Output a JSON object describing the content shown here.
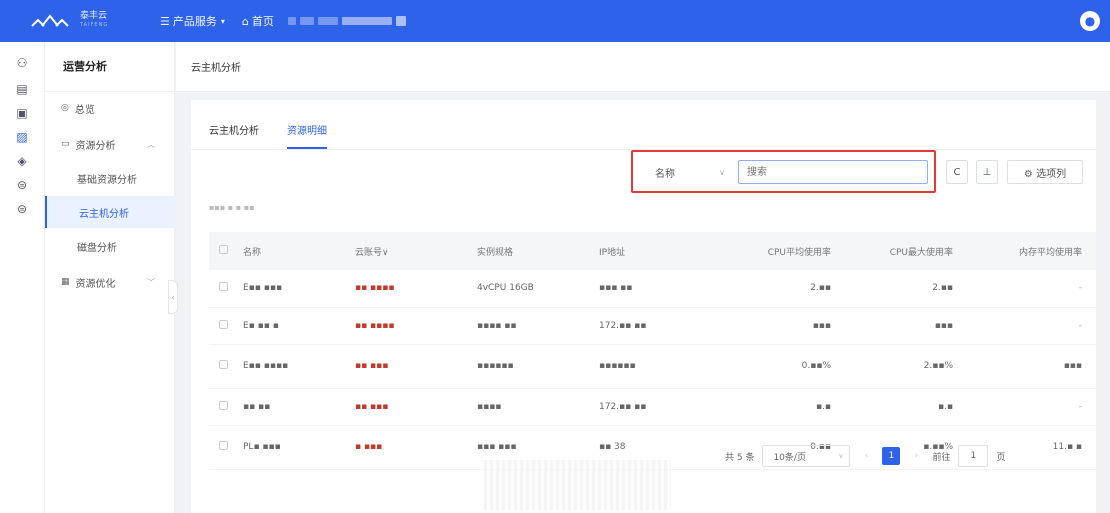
{
  "topbar": {
    "brand_cn": "泰丰云",
    "brand_en": "TAIFENG",
    "product_menu": "产品服务",
    "home": "首页",
    "avatar_initial": "●"
  },
  "rail_icons": [
    "users-icon",
    "server-icon",
    "document-icon",
    "monitor-icon",
    "shield-icon",
    "database-icon",
    "database-alt-icon"
  ],
  "sidebar": {
    "title": "运营分析",
    "items": [
      {
        "label": "总览",
        "icon": "◎"
      },
      {
        "label": "资源分析",
        "icon": "▭",
        "expanded": true
      },
      {
        "label": "基础资源分析"
      },
      {
        "label": "云主机分析",
        "active": true
      },
      {
        "label": "磁盘分析"
      },
      {
        "label": "资源优化",
        "icon": "▦"
      }
    ]
  },
  "breadcrumb": "云主机分析",
  "tabs": [
    {
      "label": "云主机分析"
    },
    {
      "label": "资源明细",
      "active": true
    }
  ],
  "filter": {
    "field": "名称",
    "placeholder": "搜索"
  },
  "toolbar": {
    "refresh": "C",
    "download": "⊥",
    "columns": "⚙ 选项列"
  },
  "table": {
    "columns": [
      "名称",
      "云账号∨",
      "实例规格",
      "IP地址",
      "CPU平均使用率",
      "CPU最大使用率",
      "内存平均使用率"
    ],
    "rows": [
      [
        "E▪▪ ▪▪▪",
        "▪▪ ▪▪▪▪",
        "4vCPU 16GB",
        "▪▪▪  ▪▪",
        "2.▪▪",
        "2.▪▪",
        "-"
      ],
      [
        "E▪ ▪▪ ▪",
        "▪▪ ▪▪▪▪",
        "▪▪▪▪ ▪▪",
        "172.▪▪  ▪▪",
        "▪▪▪",
        "▪▪▪",
        "-"
      ],
      [
        "E▪▪ ▪▪▪▪",
        "▪▪ ▪▪▪",
        "▪▪▪▪▪▪",
        "▪▪▪▪▪▪",
        "0.▪▪%",
        "2.▪▪%",
        "▪▪▪"
      ],
      [
        "▪▪ ▪▪",
        "▪▪ ▪▪▪",
        "▪▪▪▪",
        "172.▪▪  ▪▪",
        "▪.▪",
        "▪.▪",
        "-"
      ],
      [
        "PL▪ ▪▪▪",
        "▪ ▪▪▪",
        "▪▪▪ ▪▪▪",
        "▪▪ 38",
        "0.▪▪",
        "▪.▪▪%",
        "11.▪ ▪"
      ]
    ]
  },
  "pagination": {
    "total": "共 5 条",
    "page_size": "10条/页",
    "current_page": "1",
    "goto_label": "前往",
    "goto_value": "1",
    "page_unit": "页"
  },
  "colors": {
    "primary": "#2e62e8",
    "highlight_border": "#e53935"
  }
}
